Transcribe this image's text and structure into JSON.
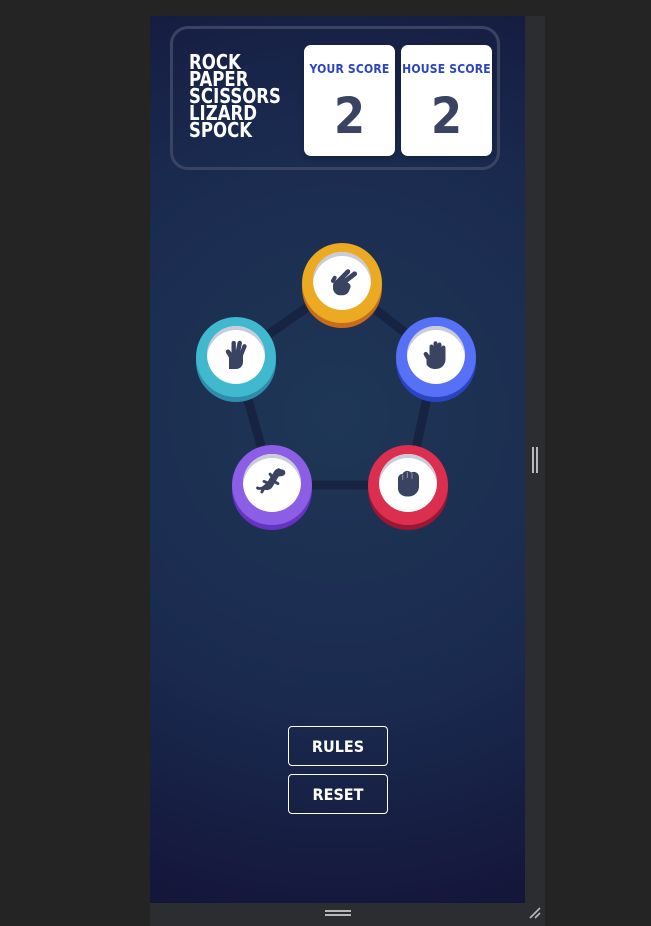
{
  "game": {
    "title_lines": [
      "ROCK",
      "PAPER",
      "SCISSORS",
      "LIZARD",
      "SPOCK"
    ]
  },
  "scores": {
    "your_label": "YOUR SCORE",
    "your_value": "2",
    "house_label": "HOUSE SCORE",
    "house_value": "2"
  },
  "choices": [
    {
      "id": "scissors",
      "icon": "scissors-hand-icon",
      "color": "#eca922"
    },
    {
      "id": "paper",
      "icon": "paper-hand-icon",
      "color": "#5671f5"
    },
    {
      "id": "rock",
      "icon": "rock-fist-icon",
      "color": "#dc2e4e"
    },
    {
      "id": "lizard",
      "icon": "lizard-icon",
      "color": "#8c5de5"
    },
    {
      "id": "spock",
      "icon": "spock-hand-icon",
      "color": "#40b9ce"
    }
  ],
  "buttons": {
    "rules_label": "RULES",
    "reset_label": "RESET"
  },
  "colors": {
    "background_dark": "#141539",
    "background_light": "#1f3756",
    "header_outline": "#3b4363",
    "score_label": "#2a45c2",
    "score_text": "#3b4363"
  }
}
